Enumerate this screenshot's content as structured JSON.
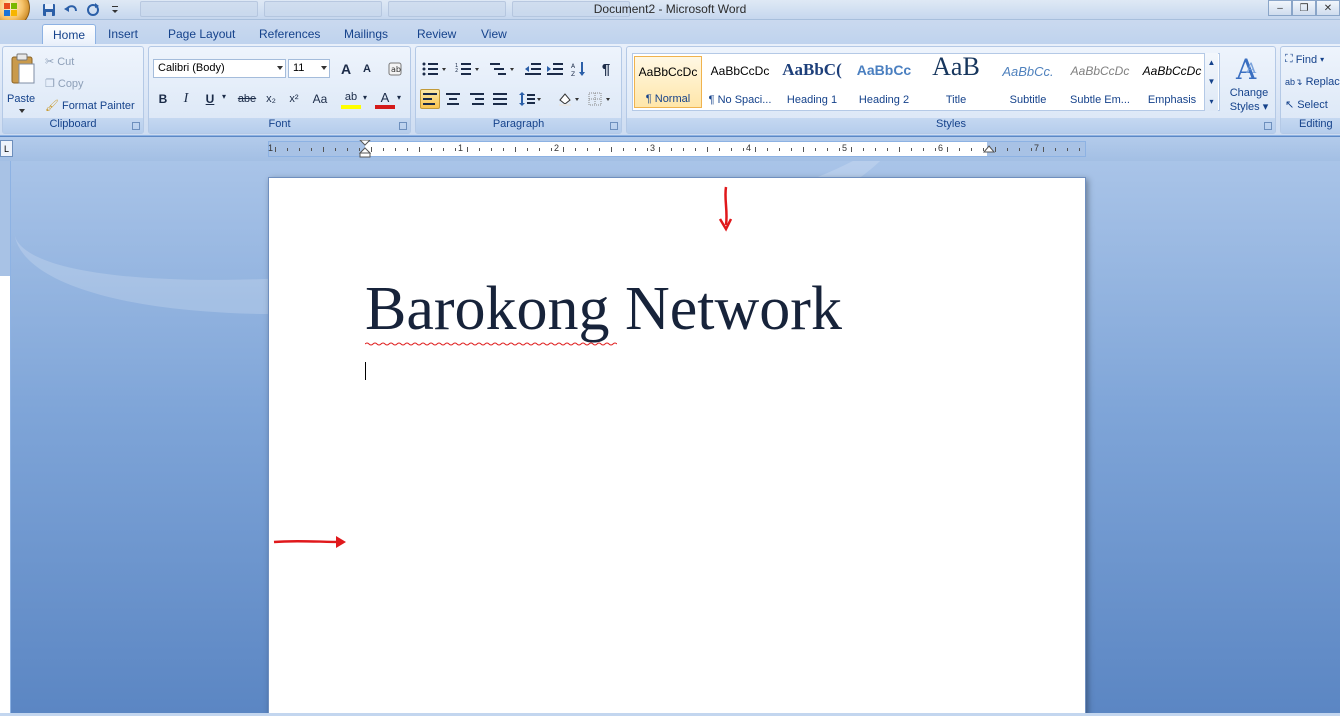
{
  "window": {
    "title": "Document2 - Microsoft Word"
  },
  "tabs": [
    {
      "label": "Home",
      "active": true
    },
    {
      "label": "Insert",
      "active": false
    },
    {
      "label": "Page Layout",
      "active": false
    },
    {
      "label": "References",
      "active": false
    },
    {
      "label": "Mailings",
      "active": false
    },
    {
      "label": "Review",
      "active": false
    },
    {
      "label": "View",
      "active": false
    }
  ],
  "clipboard": {
    "paste_label": "Paste",
    "cut_label": "Cut",
    "copy_label": "Copy",
    "format_painter_label": "Format Painter",
    "group_label": "Clipboard"
  },
  "font": {
    "font_name": "Calibri (Body)",
    "font_size": "11",
    "grow_label": "A",
    "shrink_label": "A",
    "bold": "B",
    "italic": "I",
    "underline": "U",
    "strikethrough": "abe",
    "subscript": "x₂",
    "superscript": "x²",
    "change_case": "Aa",
    "highlight": "ab",
    "font_color": "A",
    "group_label": "Font"
  },
  "paragraph": {
    "show_marks": "¶",
    "group_label": "Paragraph"
  },
  "styles": {
    "items": [
      {
        "sample": "AaBbCcDc",
        "name": "¶ Normal",
        "active": true
      },
      {
        "sample": "AaBbCcDc",
        "name": "¶ No Spaci...",
        "active": false
      },
      {
        "sample": "AaBbC(",
        "name": "Heading 1",
        "active": false
      },
      {
        "sample": "AaBbCc",
        "name": "Heading 2",
        "active": false
      },
      {
        "sample": "AaB",
        "name": "Title",
        "active": false
      },
      {
        "sample": "AaBbCc.",
        "name": "Subtitle",
        "active": false
      },
      {
        "sample": "AaBbCcDc",
        "name": "Subtle Em...",
        "active": false
      },
      {
        "sample": "AaBbCcDc",
        "name": "Emphasis",
        "active": false
      }
    ],
    "change_styles_line1": "Change",
    "change_styles_line2": "Styles",
    "group_label": "Styles"
  },
  "editing": {
    "find_label": "Find",
    "replace_label": "Replac",
    "select_label": "Select",
    "group_label": "Editing"
  },
  "ruler": {
    "numbers": [
      "1",
      "1",
      "2",
      "3",
      "4",
      "5",
      "6",
      "7"
    ],
    "tab_selector": "L"
  },
  "document": {
    "heading_text": "Barokong Network"
  },
  "colors": {
    "ribbon_text": "#15428b",
    "annotation_arrow": "#e0181b",
    "active_style_border": "#f0b34e"
  }
}
